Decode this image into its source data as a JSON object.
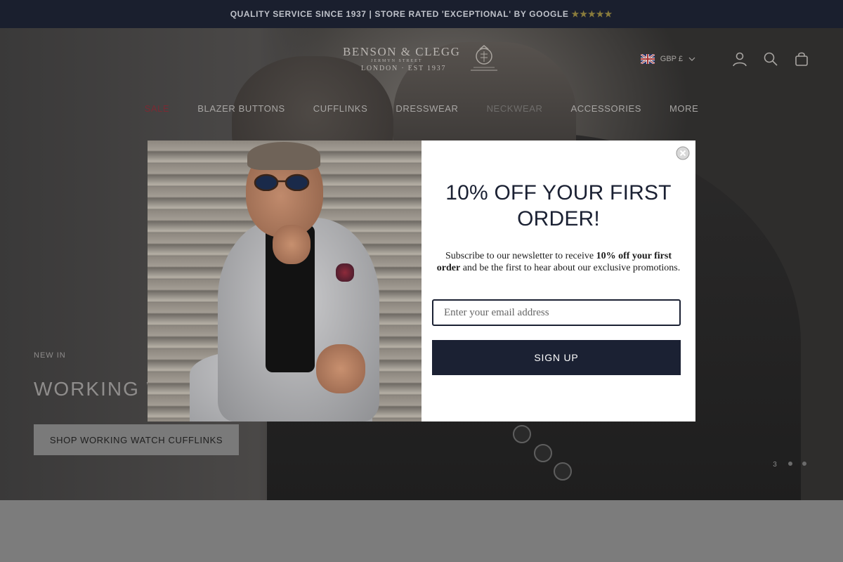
{
  "announcement": {
    "text": "QUALITY SERVICE SINCE 1937 | STORE RATED 'EXCEPTIONAL' BY GOOGLE",
    "stars": "★★★★★"
  },
  "header": {
    "logo": {
      "name": "BENSON & CLEGG",
      "street": "JERMYN STREET",
      "est": "LONDON · EST 1937"
    },
    "currency": "GBP £",
    "icons": [
      "account-icon",
      "search-icon",
      "bag-icon"
    ]
  },
  "nav": {
    "items": [
      "SALE",
      "BLAZER BUTTONS",
      "CUFFLINKS",
      "DRESSWEAR",
      "NECKWEAR",
      "ACCESSORIES",
      "MORE"
    ]
  },
  "hero": {
    "eyebrow": "NEW IN",
    "title": "WORKING W",
    "cta": "SHOP WORKING WATCH CUFFLINKS",
    "slide_indicator": "3"
  },
  "modal": {
    "title": "10% OFF YOUR FIRST ORDER!",
    "desc_pre": "Subscribe to our newsletter to receive ",
    "desc_bold": "10% off your first order",
    "desc_post": " and be the first to hear about our exclusive promotions.",
    "email_placeholder": "Enter your email address",
    "button": "SIGN UP"
  },
  "colors": {
    "navy": "#1b2133",
    "sale_red": "#7a2a33",
    "announce_bg": "#1a1f2e"
  }
}
